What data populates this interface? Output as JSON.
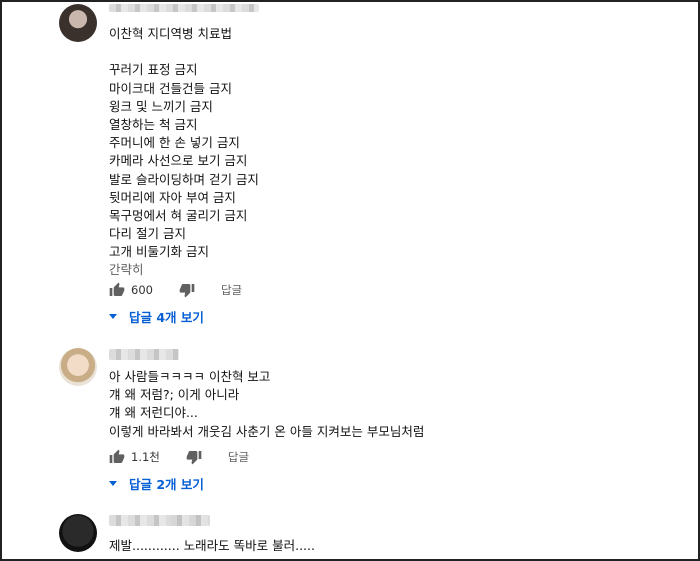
{
  "comments": [
    {
      "lines": [
        "이찬혁 지디역병 치료법",
        "",
        "꾸러기 표정 금지",
        "마이크대 건들건들 금지",
        "윙크 및 느끼기 금지",
        "열창하는 척 금지",
        "주머니에 한 손 넣기 금지",
        "카메라 사선으로 보기 금지",
        "발로 슬라이딩하며 걷기 금지",
        "뒷머리에 자아 부여 금지",
        "목구멍에서 혀 굴리기 금지",
        "다리 절기 금지",
        "고개 비둘기화 금지"
      ],
      "read_less": "간략히",
      "likes": "600",
      "reply_label": "답글",
      "view_replies": "답글 4개 보기"
    },
    {
      "lines": [
        "아 사람들ㅋㅋㅋㅋ 이찬혁 보고",
        "걔 왜 저럼?; 이게 아니라",
        "걔 왜 저런디야...",
        "이렇게 바라봐서 개웃김 사춘기 온 아들 지켜보는 부모님처럼"
      ],
      "likes": "1.1천",
      "reply_label": "답글",
      "view_replies": "답글 2개 보기"
    },
    {
      "lines": [
        "제발............ 노래라도 똑바로 불러....."
      ]
    }
  ],
  "icons": {
    "like": "thumbs-up-icon",
    "dislike": "thumbs-down-icon",
    "expand": "caret-down-icon"
  },
  "colors": {
    "link_blue": "#065fd4",
    "meta_gray": "#606060"
  }
}
